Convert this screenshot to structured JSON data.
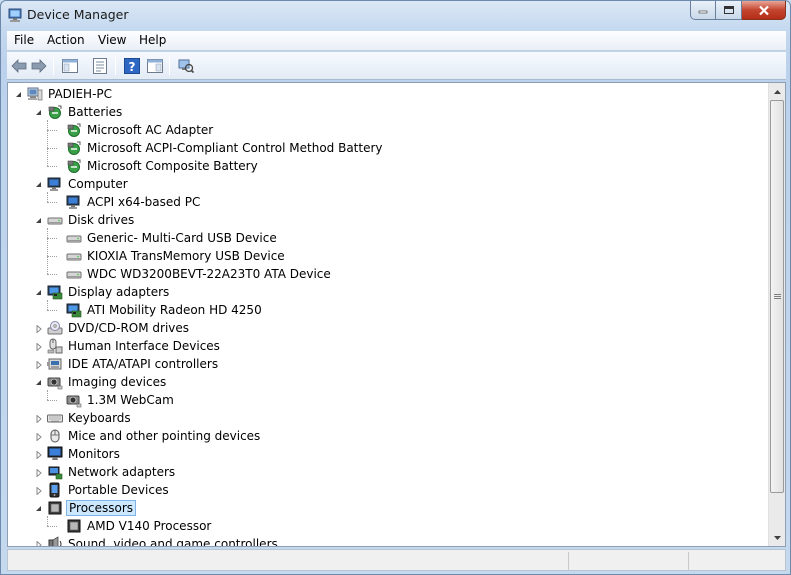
{
  "window": {
    "title": "Device Manager"
  },
  "menubar": {
    "items": [
      "File",
      "Action",
      "View",
      "Help"
    ]
  },
  "toolbar": {
    "buttons": [
      "back-arrow-icon",
      "forward-arrow-icon",
      "show-hide-console-tree-icon",
      "properties-icon",
      "help-icon",
      "action-pane-icon",
      "scan-hardware-icon"
    ]
  },
  "tree": {
    "root": "PADIEH-PC",
    "nodes": [
      {
        "label": "Batteries",
        "level": 1,
        "expanded": true,
        "icon": "battery-icon"
      },
      {
        "label": "Microsoft AC Adapter",
        "level": 2,
        "icon": "battery-icon"
      },
      {
        "label": "Microsoft ACPI-Compliant Control Method Battery",
        "level": 2,
        "icon": "battery-icon"
      },
      {
        "label": "Microsoft Composite Battery",
        "level": 2,
        "icon": "battery-icon"
      },
      {
        "label": "Computer",
        "level": 1,
        "expanded": true,
        "icon": "computer-icon"
      },
      {
        "label": "ACPI x64-based PC",
        "level": 2,
        "icon": "computer-icon"
      },
      {
        "label": "Disk drives",
        "level": 1,
        "expanded": true,
        "icon": "disk-drive-icon"
      },
      {
        "label": "Generic- Multi-Card USB Device",
        "level": 2,
        "icon": "disk-drive-icon"
      },
      {
        "label": "KIOXIA TransMemory USB Device",
        "level": 2,
        "icon": "disk-drive-icon"
      },
      {
        "label": "WDC WD3200BEVT-22A23T0 ATA Device",
        "level": 2,
        "icon": "disk-drive-icon"
      },
      {
        "label": "Display adapters",
        "level": 1,
        "expanded": true,
        "icon": "display-adapter-icon"
      },
      {
        "label": "ATI Mobility Radeon HD 4250",
        "level": 2,
        "icon": "display-adapter-icon"
      },
      {
        "label": "DVD/CD-ROM drives",
        "level": 1,
        "expanded": false,
        "icon": "dvd-drive-icon"
      },
      {
        "label": "Human Interface Devices",
        "level": 1,
        "expanded": false,
        "icon": "hid-icon"
      },
      {
        "label": "IDE ATA/ATAPI controllers",
        "level": 1,
        "expanded": false,
        "icon": "ide-controller-icon"
      },
      {
        "label": "Imaging devices",
        "level": 1,
        "expanded": true,
        "icon": "camera-icon"
      },
      {
        "label": "1.3M WebCam",
        "level": 2,
        "icon": "camera-icon"
      },
      {
        "label": "Keyboards",
        "level": 1,
        "expanded": false,
        "icon": "keyboard-icon"
      },
      {
        "label": "Mice and other pointing devices",
        "level": 1,
        "expanded": false,
        "icon": "mouse-icon"
      },
      {
        "label": "Monitors",
        "level": 1,
        "expanded": false,
        "icon": "monitor-icon"
      },
      {
        "label": "Network adapters",
        "level": 1,
        "expanded": false,
        "icon": "network-adapter-icon"
      },
      {
        "label": "Portable Devices",
        "level": 1,
        "expanded": false,
        "icon": "portable-device-icon"
      },
      {
        "label": "Processors",
        "level": 1,
        "expanded": true,
        "selected": true,
        "icon": "processor-icon"
      },
      {
        "label": "AMD V140 Processor",
        "level": 2,
        "icon": "processor-icon"
      },
      {
        "label": "Sound, video and game controllers",
        "level": 1,
        "expanded": false,
        "icon": "sound-icon"
      }
    ]
  },
  "colors": {
    "selection_bg": "#cce8ff",
    "selection_border": "#7eb4ea",
    "close_button": "#c4452f"
  }
}
